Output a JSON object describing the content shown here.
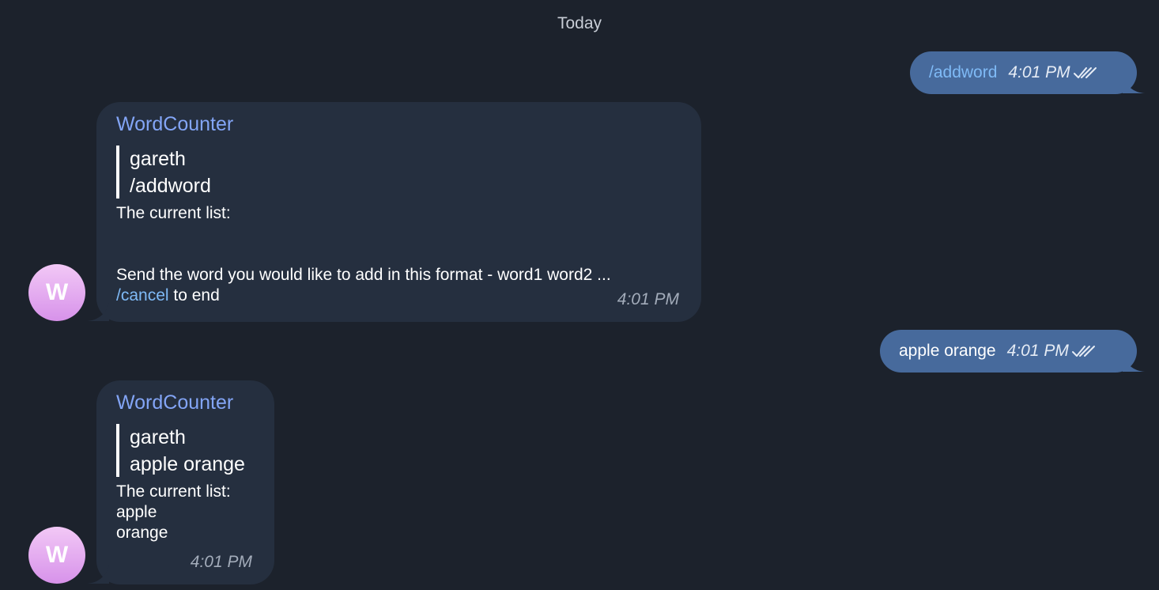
{
  "date_separator": "Today",
  "messages": [
    {
      "direction": "out",
      "text": "/addword",
      "time": "4:01 PM",
      "status_icon": "double-check-icon"
    },
    {
      "direction": "in",
      "sender": "WordCounter",
      "reply_to": {
        "name": "gareth",
        "text": "/addword"
      },
      "lines": [
        "The current list:",
        "",
        "",
        "Send the word you would like to add in this format - word1 word2 ..."
      ],
      "cancel_link": "/cancel",
      "cancel_suffix": " to end",
      "time": "4:01 PM",
      "avatar_letter": "W"
    },
    {
      "direction": "out",
      "text": "apple orange",
      "time": "4:01 PM",
      "status_icon": "double-check-icon"
    },
    {
      "direction": "in",
      "sender": "WordCounter",
      "reply_to": {
        "name": "gareth",
        "text": "apple orange"
      },
      "lines": [
        "The current list:",
        "apple",
        "orange"
      ],
      "time": "4:01 PM",
      "avatar_letter": "W"
    }
  ],
  "colors": {
    "background": "#1c222c",
    "outgoing_bubble": "#476a9c",
    "incoming_bubble": "#252f3f",
    "sender_name": "#83a5f6",
    "link": "#7fbaf6"
  }
}
